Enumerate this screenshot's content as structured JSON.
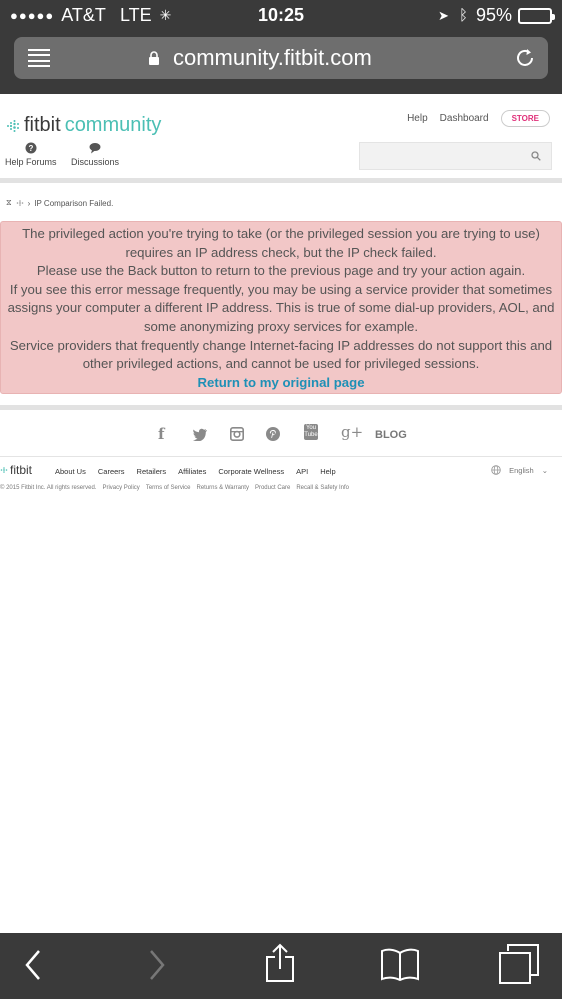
{
  "status_bar": {
    "signal_dots": "●●●●●",
    "carrier": "AT&T",
    "network": "LTE",
    "time": "10:25",
    "battery_percent": "95%",
    "battery_level": 0.95
  },
  "browser": {
    "url": "community.fitbit.com"
  },
  "header": {
    "logo_brand": "fitbit",
    "logo_section": "community",
    "links": {
      "help": "Help",
      "dashboard": "Dashboard",
      "store": "STORE"
    },
    "nav": {
      "help_forums": "Help Forums",
      "discussions": "Discussions"
    },
    "search_placeholder": ""
  },
  "breadcrumb": {
    "current": "IP Comparison Failed."
  },
  "error": {
    "line1": "The privileged action you're trying to take (or the privileged session you are trying to use) requires an IP address check, but the IP check failed.",
    "line2": "Please use the Back button to return to the previous page and try your action again.",
    "line3": "If you see this error message frequently, you may be using a service provider that sometimes assigns your computer a different IP address. This is true of some dial-up providers, AOL, and some anonymizing proxy services for example.",
    "line4": "Service providers that frequently change Internet-facing IP addresses do not support this and other privileged actions, and cannot be used for privileged sessions.",
    "return_link": "Return to my original page"
  },
  "social": {
    "facebook": "f",
    "twitter_icon": "twitter-icon",
    "instagram_icon": "instagram-icon",
    "pinterest_icon": "pinterest-icon",
    "youtube": "You Tube",
    "googleplus": "g+",
    "blog": "BLOG"
  },
  "footer": {
    "logo": "fitbit",
    "links": [
      "About Us",
      "Careers",
      "Retailers",
      "Affiliates",
      "Corporate Wellness",
      "API",
      "Help"
    ],
    "language": "English",
    "copyright": "© 2015 Fitbit Inc. All rights reserved.",
    "legal": [
      "Privacy Policy",
      "Terms of Service",
      "Returns & Warranty",
      "Product Care",
      "Recall & Safety Info"
    ]
  },
  "colors": {
    "accent": "#4bbfb4",
    "store": "#e0307a",
    "error_bg": "#f2c7c7",
    "link": "#1e90b6"
  }
}
